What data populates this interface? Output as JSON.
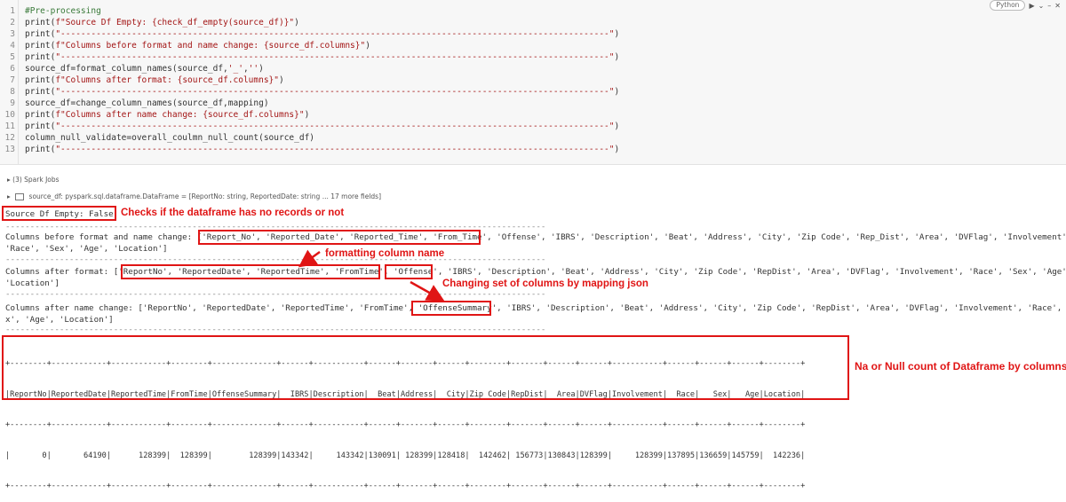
{
  "cell": {
    "language": "Python",
    "toolbar_icons": [
      "run-icon",
      "chevron-down-icon",
      "minimize-icon",
      "close-icon"
    ],
    "lines": [
      {
        "n": "1",
        "segments": [
          {
            "t": "#Pre-processing",
            "c": "cm"
          }
        ]
      },
      {
        "n": "2",
        "segments": [
          {
            "t": "print(",
            "c": "fn"
          },
          {
            "t": "f\"Source Df Empty: {check_df_empty(source_df)}\"",
            "c": "str"
          },
          {
            "t": ")",
            "c": "fn"
          }
        ]
      },
      {
        "n": "3",
        "segments": [
          {
            "t": "print(",
            "c": "fn"
          },
          {
            "t": "\"------------------------------------------------------------------------------------------------------------\"",
            "c": "str"
          },
          {
            "t": ")",
            "c": "fn"
          }
        ]
      },
      {
        "n": "4",
        "segments": [
          {
            "t": "print(",
            "c": "fn"
          },
          {
            "t": "f\"Columns before format and name change: {source_df.columns}\"",
            "c": "str"
          },
          {
            "t": ")",
            "c": "fn"
          }
        ]
      },
      {
        "n": "5",
        "segments": [
          {
            "t": "print(",
            "c": "fn"
          },
          {
            "t": "\"------------------------------------------------------------------------------------------------------------\"",
            "c": "str"
          },
          {
            "t": ")",
            "c": "fn"
          }
        ]
      },
      {
        "n": "6",
        "segments": [
          {
            "t": "source_df=format_column_names(source_df,",
            "c": "fn"
          },
          {
            "t": "'_'",
            "c": "str"
          },
          {
            "t": ",",
            "c": "fn"
          },
          {
            "t": "''",
            "c": "str"
          },
          {
            "t": ")",
            "c": "fn"
          }
        ]
      },
      {
        "n": "7",
        "segments": [
          {
            "t": "print(",
            "c": "fn"
          },
          {
            "t": "f\"Columns after format: {source_df.columns}\"",
            "c": "str"
          },
          {
            "t": ")",
            "c": "fn"
          }
        ]
      },
      {
        "n": "8",
        "segments": [
          {
            "t": "print(",
            "c": "fn"
          },
          {
            "t": "\"------------------------------------------------------------------------------------------------------------\"",
            "c": "str"
          },
          {
            "t": ")",
            "c": "fn"
          }
        ]
      },
      {
        "n": "9",
        "segments": [
          {
            "t": "source_df=change_column_names(source_df,mapping)",
            "c": "fn"
          }
        ]
      },
      {
        "n": "10",
        "segments": [
          {
            "t": "print(",
            "c": "fn"
          },
          {
            "t": "f\"Columns after name change: {source_df.columns}\"",
            "c": "str"
          },
          {
            "t": ")",
            "c": "fn"
          }
        ]
      },
      {
        "n": "11",
        "segments": [
          {
            "t": "print(",
            "c": "fn"
          },
          {
            "t": "\"------------------------------------------------------------------------------------------------------------\"",
            "c": "str"
          },
          {
            "t": ")",
            "c": "fn"
          }
        ]
      },
      {
        "n": "12",
        "segments": [
          {
            "t": "column_null_validate=overall_coulmn_null_count(source_df)",
            "c": "fn"
          }
        ]
      },
      {
        "n": "13",
        "segments": [
          {
            "t": "print(",
            "c": "fn"
          },
          {
            "t": "\"------------------------------------------------------------------------------------------------------------\"",
            "c": "str"
          },
          {
            "t": ")",
            "c": "fn"
          }
        ]
      }
    ]
  },
  "output": {
    "spark_jobs": "(3) Spark Jobs",
    "df_var": "source_df:",
    "df_type": "pyspark.sql.dataframe.DataFrame = [ReportNo: string, ReportedDate: string ... 17 more fields]",
    "empty_line": "Source Df Empty: False",
    "dash": "--------------------------------------------------------------------------------------------------------------",
    "before_1": "Columns before format and name change: [",
    "before_1_boxed": "'Report_No', 'Reported_Date', 'Reported_Time', 'From_Time'",
    "before_1_rest": ", 'Offense', 'IBRS', 'Description', 'Beat', 'Address', 'City', 'Zip Code', 'Rep_Dist', 'Area', 'DVFlag', 'Involvement',",
    "before_2": "'Race', 'Sex', 'Age', 'Location']",
    "after_fmt_1": "Columns after format: [",
    "after_fmt_1_boxed": "'ReportNo', 'ReportedDate', 'ReportedTime', 'FromTime'",
    "after_fmt_1_mid": ", ",
    "after_fmt_1_boxed2": "'Offense'",
    "after_fmt_1_rest": ", 'IBRS', 'Description', 'Beat', 'Address', 'City', 'Zip Code', 'RepDist', 'Area', 'DVFlag', 'Involvement', 'Race', 'Sex', 'Age',",
    "after_fmt_2": "'Location']",
    "after_name_1": "Columns after name change: ['ReportNo', 'ReportedDate', 'ReportedTime', 'FromTime', ",
    "after_name_1_boxed": "'OffenseSummary'",
    "after_name_1_rest": ", 'IBRS', 'Description', 'Beat', 'Address', 'City', 'Zip Code', 'RepDist', 'Area', 'DVFlag', 'Involvement', 'Race', 'Se",
    "after_name_2": "x', 'Age', 'Location']",
    "table_border": "+--------+------------+------------+--------+--------------+------+-----------+------+-------+------+--------+-------+------+------+-----------+------+------+------+--------+",
    "table_header": "|ReportNo|ReportedDate|ReportedTime|FromTime|OffenseSummary|  IBRS|Description|  Beat|Address|  City|Zip Code|RepDist|  Area|DVFlag|Involvement|  Race|   Sex|   Age|Location|",
    "table_row": "|       0|       64190|      128399|  128399|        128399|143342|     143342|130091| 128399|128418|  142462| 156773|130843|128399|     128399|137895|136659|145759|  142236|"
  },
  "annotations": {
    "empty_check": "Checks if the dataframe has no records or not",
    "formatting": "formatting column name",
    "mapping": "Changing set of columns by mapping json",
    "null_count": "Na or Null count of Dataframe by columns"
  },
  "colors": {
    "accent": "#e01515",
    "string": "#a31515",
    "comment": "#3a7a3a"
  }
}
